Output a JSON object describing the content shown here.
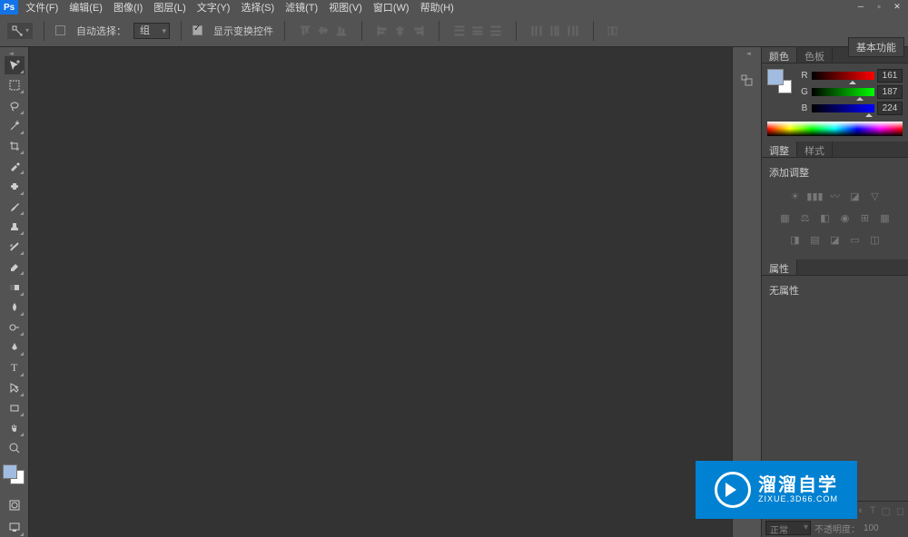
{
  "app": {
    "name": "Ps"
  },
  "menu": {
    "file": "文件(F)",
    "edit": "编辑(E)",
    "image": "图像(I)",
    "layer": "图层(L)",
    "type": "文字(Y)",
    "select": "选择(S)",
    "filter": "滤镜(T)",
    "view": "视图(V)",
    "window": "窗口(W)",
    "help": "帮助(H)"
  },
  "options": {
    "auto_select_label": "自动选择：",
    "auto_select_value": "组",
    "show_transform": "显示变换控件",
    "essentials": "基本功能"
  },
  "panels": {
    "color_tab": "颜色",
    "swatches_tab": "色板",
    "r_label": "R",
    "r_value": "161",
    "g_label": "G",
    "g_value": "187",
    "b_label": "B",
    "b_value": "224",
    "adjust_tab": "调整",
    "styles_tab": "样式",
    "add_adjust": "添加调整",
    "props_tab": "属性",
    "no_props": "无属性"
  },
  "layers": {
    "blend_mode": "正常",
    "opacity_label": "不透明度：",
    "opacity_val": "100"
  },
  "watermark": {
    "cn": "溜溜自学",
    "en": "ZIXUE.3D66.COM"
  },
  "colors": {
    "foreground": "#a1bbe0",
    "background": "#ffffff"
  }
}
